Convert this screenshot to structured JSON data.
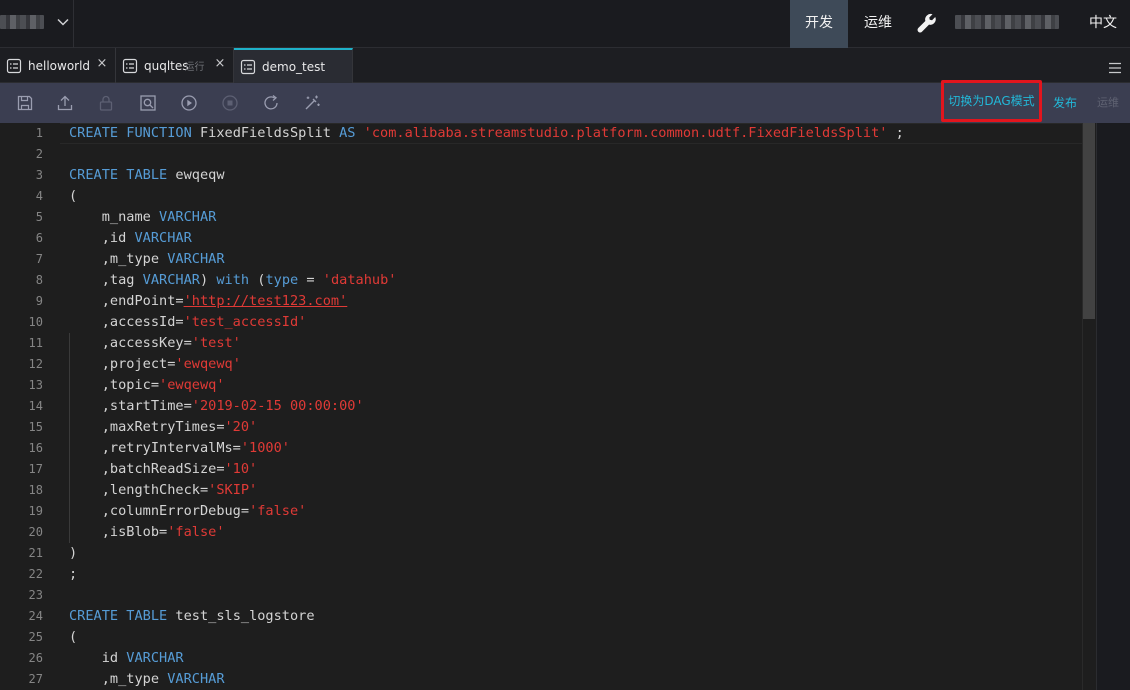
{
  "topbar": {
    "nav_dev": "开发",
    "nav_ops": "运维",
    "nav_lang": "中文",
    "accent_active_bg": "#3e4a58"
  },
  "tabs": [
    {
      "label": "helloworld",
      "close": "×"
    },
    {
      "label": "quqltes",
      "hint": "运行",
      "close": "×"
    },
    {
      "label": "demo_test",
      "active": true
    }
  ],
  "toolbar": {
    "dag_label": "切换为DAG模式",
    "publish_label": "发布",
    "ops_label": "运维",
    "highlight_color": "#e2151d",
    "link_color": "#22b8d8"
  },
  "editor": {
    "line_numbers": [
      "1",
      "2",
      "3",
      "4",
      "5",
      "6",
      "7",
      "8",
      "9",
      "10",
      "11",
      "12",
      "13",
      "14",
      "15",
      "16",
      "17",
      "18",
      "19",
      "20",
      "21",
      "22",
      "23",
      "24",
      "25",
      "26",
      "27"
    ],
    "lines": [
      [
        {
          "t": "CREATE FUNCTION ",
          "c": "kw"
        },
        {
          "t": "FixedFieldsSplit "
        },
        {
          "t": "AS ",
          "c": "kw"
        },
        {
          "t": "'com.alibaba.streamstudio.platform.common.udtf.FixedFieldsSplit'",
          "c": "str"
        },
        {
          "t": " ;"
        }
      ],
      [],
      [
        {
          "t": "CREATE TABLE ",
          "c": "kw"
        },
        {
          "t": "ewqeqw"
        }
      ],
      [
        {
          "t": "("
        }
      ],
      [
        {
          "t": "    m_name "
        },
        {
          "t": "VARCHAR",
          "c": "kw"
        }
      ],
      [
        {
          "t": "    ,id "
        },
        {
          "t": "VARCHAR",
          "c": "kw"
        }
      ],
      [
        {
          "t": "    ,m_type "
        },
        {
          "t": "VARCHAR",
          "c": "kw"
        }
      ],
      [
        {
          "t": "    ,tag "
        },
        {
          "t": "VARCHAR",
          "c": "kw"
        },
        {
          "t": ") "
        },
        {
          "t": "with",
          "c": "kw"
        },
        {
          "t": " ("
        },
        {
          "t": "type",
          "c": "kw"
        },
        {
          "t": " = "
        },
        {
          "t": "'datahub'",
          "c": "str"
        }
      ],
      [
        {
          "t": "    ,endPoint="
        },
        {
          "t": "'http://test123.com'",
          "c": "str url"
        }
      ],
      [
        {
          "t": "    ,accessId="
        },
        {
          "t": "'test_accessId'",
          "c": "str"
        }
      ],
      [
        {
          "t": "    ,accessKey="
        },
        {
          "t": "'test'",
          "c": "str"
        }
      ],
      [
        {
          "t": "    ,project="
        },
        {
          "t": "'ewqewq'",
          "c": "str"
        }
      ],
      [
        {
          "t": "    ,topic="
        },
        {
          "t": "'ewqewq'",
          "c": "str"
        }
      ],
      [
        {
          "t": "    ,startTime="
        },
        {
          "t": "'2019-02-15 00:00:00'",
          "c": "str"
        }
      ],
      [
        {
          "t": "    ,maxRetryTimes="
        },
        {
          "t": "'20'",
          "c": "str"
        }
      ],
      [
        {
          "t": "    ,retryIntervalMs="
        },
        {
          "t": "'1000'",
          "c": "str"
        }
      ],
      [
        {
          "t": "    ,batchReadSize="
        },
        {
          "t": "'10'",
          "c": "str"
        }
      ],
      [
        {
          "t": "    ,lengthCheck="
        },
        {
          "t": "'SKIP'",
          "c": "str"
        }
      ],
      [
        {
          "t": "    ,columnErrorDebug="
        },
        {
          "t": "'false'",
          "c": "str"
        }
      ],
      [
        {
          "t": "    ,isBlob="
        },
        {
          "t": "'false'",
          "c": "str"
        }
      ],
      [
        {
          "t": ")"
        }
      ],
      [
        {
          "t": ";"
        }
      ],
      [],
      [
        {
          "t": "CREATE TABLE ",
          "c": "kw"
        },
        {
          "t": "test_sls_logstore"
        }
      ],
      [
        {
          "t": "("
        }
      ],
      [
        {
          "t": "    id "
        },
        {
          "t": "VARCHAR",
          "c": "kw"
        }
      ],
      [
        {
          "t": "    ,m_type "
        },
        {
          "t": "VARCHAR",
          "c": "kw"
        }
      ]
    ],
    "colors": {
      "keyword": "#569cd6",
      "string": "#e03a36",
      "text": "#d4d4d4",
      "line_number": "#858585"
    }
  }
}
